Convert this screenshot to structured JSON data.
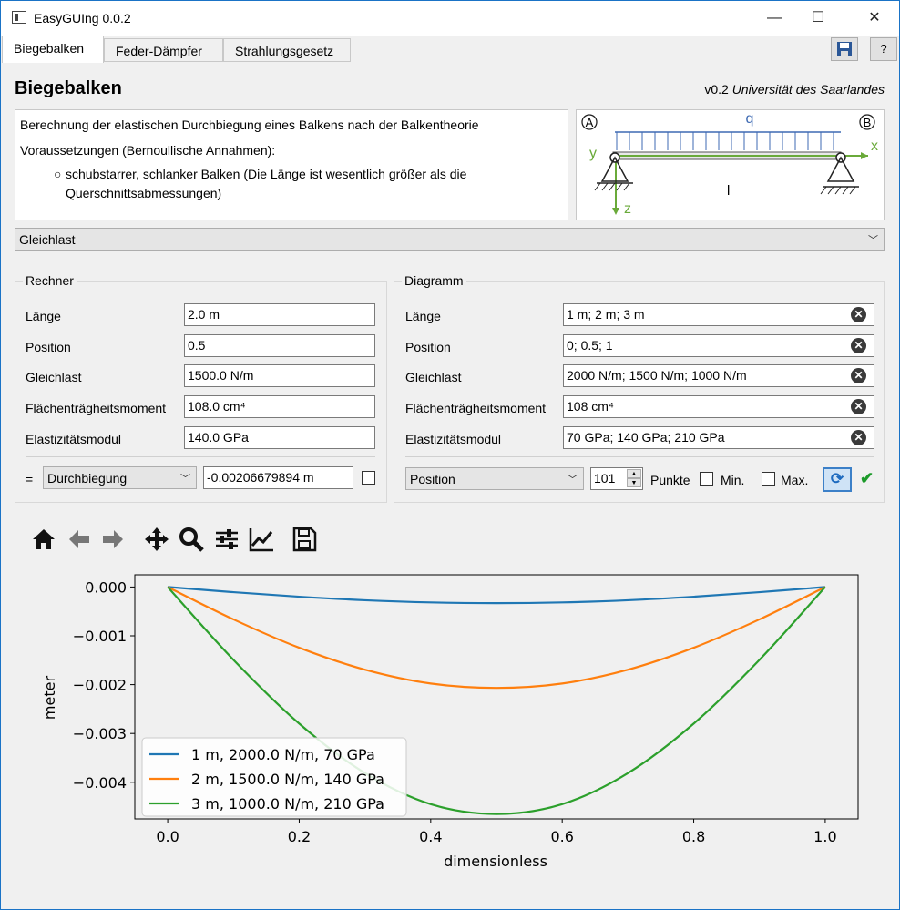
{
  "window": {
    "title": "EasyGUIng 0.0.2",
    "minimize": "—",
    "maximize": "☐",
    "close": "✕"
  },
  "tabs": [
    {
      "label": "Biegebalken",
      "active": true
    },
    {
      "label": "Feder-Dämpfer",
      "active": false
    },
    {
      "label": "Strahlungsgesetz",
      "active": false
    }
  ],
  "toolbar": {
    "save_icon": "floppy-disk-icon",
    "help_label": "?"
  },
  "page": {
    "title": "Biegebalken",
    "version": "v0.2",
    "institution": "Universität des Saarlandes"
  },
  "description": {
    "line1": "Berechnung der elastischen Durchbiegung eines Balkens nach der Balkentheorie",
    "line2": "Voraussetzungen (Bernoullische Annahmen):",
    "bullet_line1": "schubstarrer, schlanker Balken (Die Länge ist wesentlich größer als die",
    "bullet_line2": "Querschnittsabmessungen)"
  },
  "beam_diagram": {
    "support_a": "A",
    "support_b": "B",
    "load": "q",
    "x_axis": "x",
    "y_axis": "y",
    "z_axis": "z",
    "length": "l"
  },
  "load_case": {
    "selected": "Gleichlast"
  },
  "rechner": {
    "title": "Rechner",
    "fields": [
      {
        "label": "Länge",
        "value": "2.0 m"
      },
      {
        "label": "Position",
        "value": "0.5"
      },
      {
        "label": "Gleichlast",
        "value": "1500.0 N/m"
      },
      {
        "label": "Flächenträgheitsmoment",
        "value": "108.0 cm⁴"
      },
      {
        "label": "Elastizitätsmodul",
        "value": "140.0 GPa"
      }
    ],
    "equals": "=",
    "result_select": "Durchbiegung",
    "result_value": "-0.00206679894 m"
  },
  "diagramm": {
    "title": "Diagramm",
    "fields": [
      {
        "label": "Länge",
        "value": "1 m; 2 m; 3 m"
      },
      {
        "label": "Position",
        "value": "0; 0.5; 1"
      },
      {
        "label": "Gleichlast",
        "value": "2000 N/m; 1500 N/m; 1000 N/m"
      },
      {
        "label": "Flächenträgheitsmoment",
        "value": "108 cm⁴"
      },
      {
        "label": "Elastizitätsmodul",
        "value": "70 GPa; 140 GPa; 210 GPa"
      }
    ],
    "x_select": "Position",
    "points": "101",
    "points_label": "Punkte",
    "min_label": "Min.",
    "max_label": "Max."
  },
  "plot_toolbar": [
    "home-icon",
    "back-icon",
    "forward-icon",
    "pan-icon",
    "zoom-icon",
    "configure-subplots-icon",
    "edit-axis-icon",
    "save-figure-icon"
  ],
  "chart_data": {
    "type": "line",
    "title": "",
    "xlabel": "dimensionless",
    "ylabel": "meter",
    "xlim": [
      -0.05,
      1.05
    ],
    "ylim": [
      -0.00475,
      0.00025
    ],
    "xticks": [
      "0.0",
      "0.2",
      "0.4",
      "0.6",
      "0.8",
      "1.0"
    ],
    "yticks": [
      "0.000",
      "−0.001",
      "−0.002",
      "−0.003",
      "−0.004"
    ],
    "legend_position": "lower-left",
    "grid": false,
    "x": [
      0.0,
      0.1,
      0.2,
      0.3,
      0.4,
      0.5,
      0.6,
      0.7,
      0.8,
      0.9,
      1.0
    ],
    "series": [
      {
        "name": "1 m, 2000.0 N/m, 70 GPa",
        "color": "#1f77b4",
        "values": [
          0.0,
          -0.000106,
          -0.000199,
          -0.000271,
          -0.000316,
          -0.000331,
          -0.000316,
          -0.000271,
          -0.000199,
          -0.000106,
          0.0
        ]
      },
      {
        "name": "2 m, 1500.0 N/m, 140 GPa",
        "color": "#ff7f0e",
        "values": [
          0.0,
          -0.000663,
          -0.001244,
          -0.001694,
          -0.001977,
          -0.002067,
          -0.001977,
          -0.001694,
          -0.001244,
          -0.000663,
          0.0
        ]
      },
      {
        "name": "3 m, 1000.0 N/m, 210 GPa",
        "color": "#2ca02c",
        "values": [
          0.0,
          -0.001492,
          -0.002798,
          -0.003811,
          -0.004448,
          -0.00465,
          -0.004448,
          -0.003811,
          -0.002798,
          -0.001492,
          0.0
        ]
      }
    ]
  }
}
